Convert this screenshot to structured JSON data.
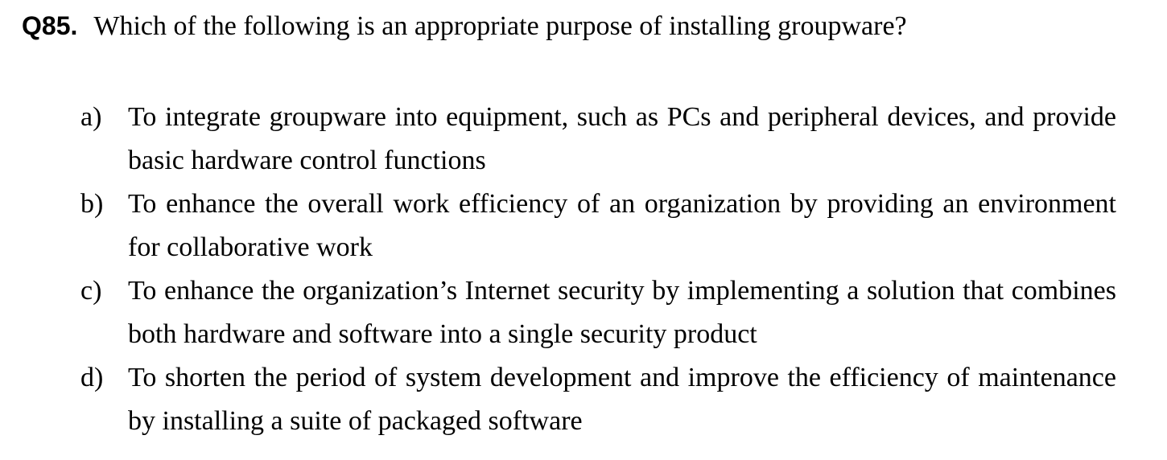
{
  "question": {
    "number": "Q85.",
    "text": "Which of the following is an appropriate purpose of installing groupware?"
  },
  "options": [
    {
      "letter": "a)",
      "text": "To integrate groupware into equipment, such as PCs and peripheral devices, and provide basic hardware control functions"
    },
    {
      "letter": "b)",
      "text": "To enhance the overall work efficiency of an organization by providing an environment for collaborative work"
    },
    {
      "letter": "c)",
      "text": "To enhance the organization’s Internet security by implementing a solution that combines both hardware and software into a single security product"
    },
    {
      "letter": "d)",
      "text": "To shorten the period of system development and improve the efficiency of maintenance by installing a suite of packaged software"
    }
  ]
}
